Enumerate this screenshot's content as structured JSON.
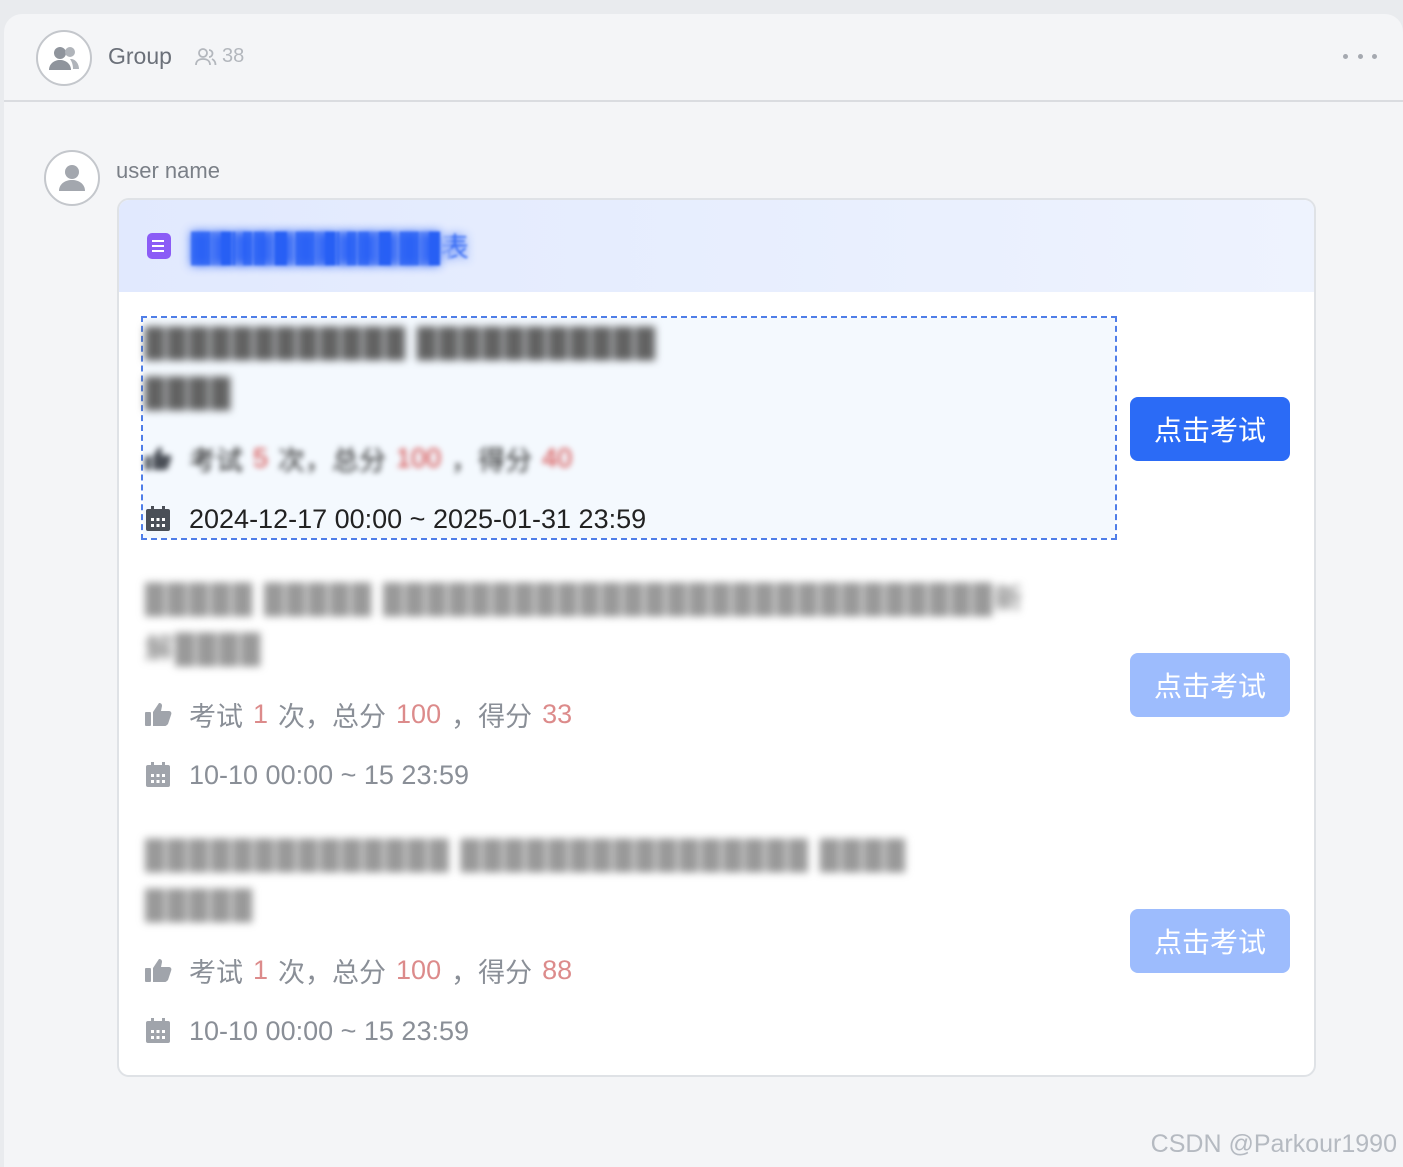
{
  "header": {
    "group_name": "Group",
    "member_count": "38",
    "more_icon": "more-horizontal-icon"
  },
  "message": {
    "sender_name": "user name",
    "card": {
      "title": "████████████表",
      "exams": [
        {
          "name": "████████████ ███████████",
          "subtitle": "████",
          "attempts": "5",
          "total": "100",
          "score": "40",
          "period": "2024-12-17 00:00 ~ 2025-01-31 23:59",
          "button_label": "点击考试",
          "state": "active"
        },
        {
          "name": "█████ █████ ████████████████████████████新",
          "subtitle": "解████",
          "attempts": "1",
          "total": "100",
          "score": "33",
          "period": "10-10 00:00 ~ 15 23:59",
          "button_label": "点击考试",
          "state": "disabled"
        },
        {
          "name": "██████████████ ████████████████ ████",
          "subtitle": "█████",
          "attempts": "1",
          "total": "100",
          "score": "88",
          "period": "10-10 00:00 ~ 15 23:59",
          "button_label": "点击考试",
          "state": "disabled"
        }
      ],
      "labels": {
        "exam_prefix": "考试",
        "times_unit": "次，总分",
        "score_prefix": "，得分"
      }
    }
  },
  "watermark": "CSDN @Parkour1990",
  "colors": {
    "primary_button": "#2b6bf6",
    "disabled_button": "#9dbcfd",
    "number_red": "#d23b3b",
    "doc_icon": "#8b5cf6"
  }
}
